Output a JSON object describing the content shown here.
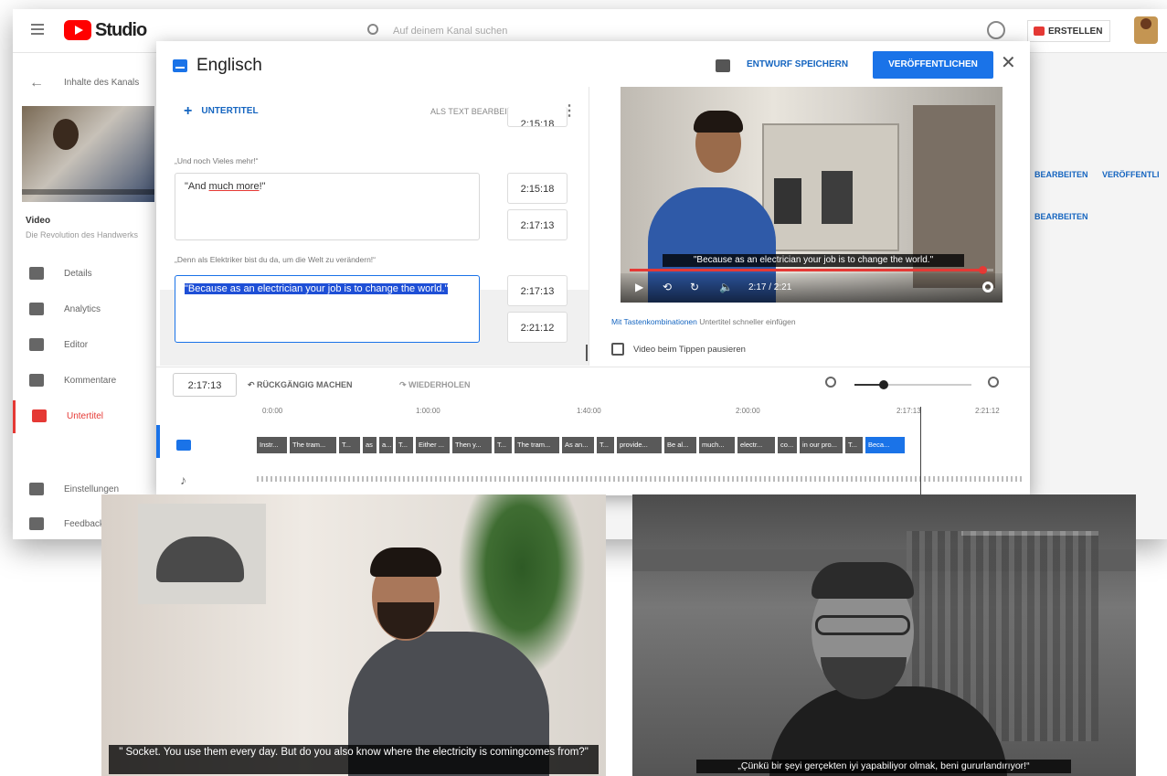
{
  "studio": {
    "logo_text": "Studio",
    "search_placeholder": "Auf deinem Kanal suchen",
    "create_label": "ERSTELLEN",
    "back_label": "Inhalte des Kanals",
    "video_title": "Video",
    "video_sub": "Die Revolution des Handwerks",
    "nav": [
      {
        "label": "Details",
        "icon": "pencil-icon"
      },
      {
        "label": "Analytics",
        "icon": "analytics-icon"
      },
      {
        "label": "Editor",
        "icon": "film-icon"
      },
      {
        "label": "Kommentare",
        "icon": "comment-icon"
      },
      {
        "label": "Untertitel",
        "icon": "subtitles-icon",
        "active": true
      },
      {
        "label": "Einstellungen",
        "icon": "gear-icon"
      },
      {
        "label": "Feedback",
        "icon": "feedback-icon"
      }
    ],
    "right_links": [
      "BEARBEITEN",
      "VERÖFFENTLI",
      "BEARBEITEN"
    ]
  },
  "modal": {
    "title": "Englisch",
    "draft_label": "ENTWURF SPEICHERN",
    "publish_label": "VERÖFFENTLICHEN",
    "add_subtitle": "UNTERTITEL",
    "edit_as_text": "ALS TEXT BEARBEITEN",
    "rows": [
      {
        "original": "„Und noch Vieles mehr!“",
        "text_plain": "\"And ",
        "text_underlined": "much more",
        "text_tail": "!\"",
        "start": "2:15:18",
        "end": "2:17:13"
      },
      {
        "original": "„Denn als Elektriker bist du da, um die Welt zu verändern!“",
        "text": "\"Because as an electrician your job is to change the world.\"",
        "start": "2:17:13",
        "end": "2:21:12",
        "selected": true
      }
    ],
    "prev_time": "2:15:18",
    "player": {
      "caption": "\"Because as an electrician your job is to change the world.\"",
      "time": "2:17 / 2:21",
      "progress": 0.97
    },
    "shortcut_link": "Mit Tastenkombinationen",
    "shortcut_rest": " Untertitel schneller einfügen",
    "pause_label": "Video beim Tippen pausieren",
    "current_time": "2:17:13",
    "undo_label": "RÜCKGÄNGIG MACHEN",
    "redo_label": "WIEDERHOLEN",
    "zoom_level": 0.25,
    "ticks": [
      "0:0:00",
      "1:00:00",
      "1:40:00",
      "2:00:00",
      "2:17:13",
      "2:21:12"
    ],
    "segments": [
      "Instr...",
      "The tram...",
      "T...",
      "as",
      "a...",
      "T...",
      "Either ...",
      "Then y...",
      "T...",
      "The tram...",
      "As an...",
      "T...",
      "provide...",
      "Be al...",
      "much...",
      "electr...",
      "co...",
      "in our pro...",
      "T...",
      "Beca..."
    ]
  },
  "frames": {
    "left_caption": "\" Socket. You use them every day. But do you also know where the electricity is comingcomes from?\"",
    "right_caption": "„Çünkü bir şeyi gerçekten iyi yapabiliyor olmak, beni gururlandırıyor!“"
  }
}
